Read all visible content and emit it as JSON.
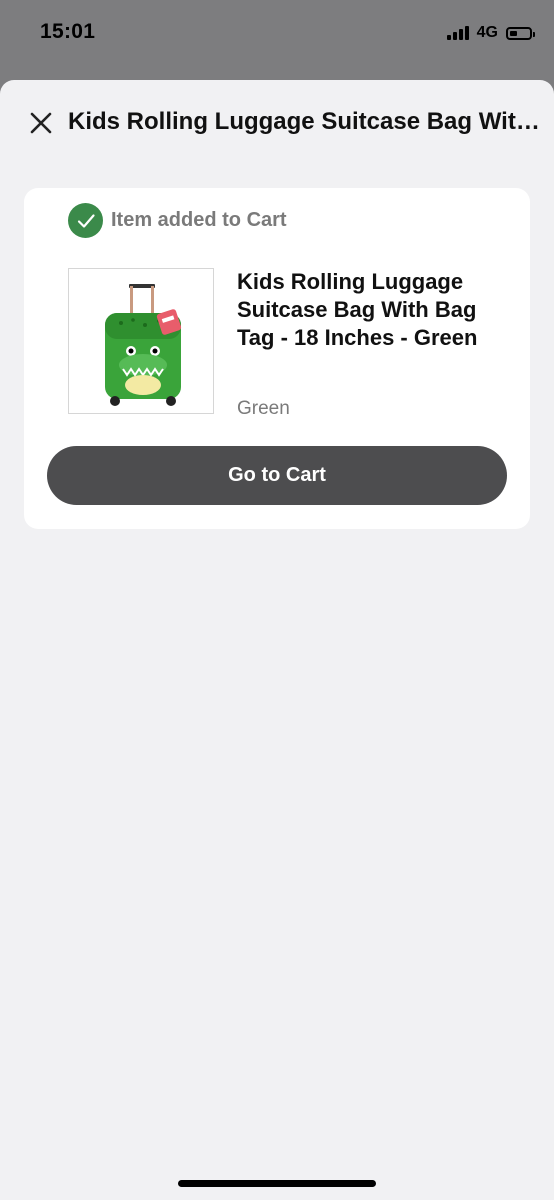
{
  "status_bar": {
    "time": "15:01",
    "network": "4G",
    "battery_level": 0.4,
    "signal_bars": 4
  },
  "header": {
    "title": "Kids Rolling Luggage Suitcase Bag With Bag Tag - 18 Inches - Green",
    "close_icon": "close-icon"
  },
  "confirmation": {
    "message": "Item added to Cart",
    "icon": "check-circle-icon",
    "icon_color": "#3b8a4a"
  },
  "product": {
    "name": "Kids Rolling Luggage Suitcase Bag With Bag Tag - 18 Inches - Green",
    "variant": "Green",
    "image": "green-crocodile-kids-suitcase"
  },
  "actions": {
    "go_to_cart_label": "Go to Cart",
    "button_color": "#4d4d4f"
  },
  "colors": {
    "sheet_background": "#f1f1f3",
    "overlay": "#7d7d7f"
  }
}
